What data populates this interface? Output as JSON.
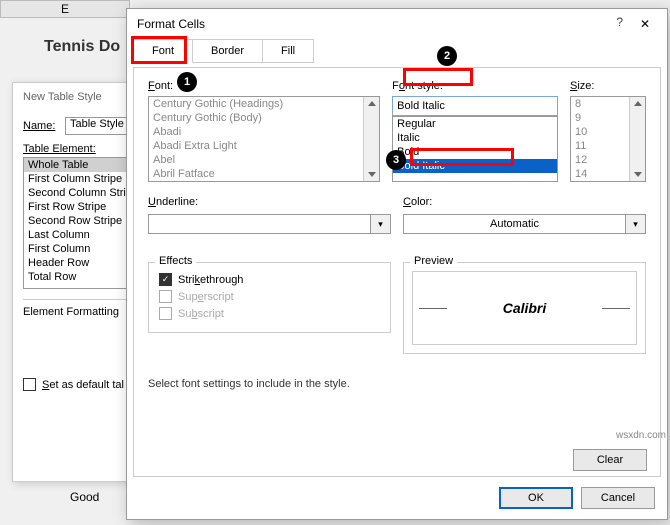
{
  "bg": {
    "col_letter": "E",
    "title_text": "Tennis Do",
    "good": "Good"
  },
  "first_dialog": {
    "title": "New Table Style",
    "name_label": "Name:",
    "name_value": "Table Style",
    "element_label": "Table Element:",
    "elements": [
      "Whole Table",
      "First Column Stripe",
      "Second Column Stripe",
      "First Row Stripe",
      "Second Row Stripe",
      "Last Column",
      "First Column",
      "Header Row",
      "Total Row"
    ],
    "selected_element": "Whole Table",
    "formatting_label": "Element Formatting",
    "default_label": "Set as default table"
  },
  "fc": {
    "title": "Format Cells",
    "tabs": {
      "font": "Font",
      "border": "Border",
      "fill": "Fill"
    },
    "font_label": "Font:",
    "fonts": [
      "Century Gothic (Headings)",
      "Century Gothic (Body)",
      "Abadi",
      "Abadi Extra Light",
      "Abel",
      "Abril Fatface"
    ],
    "style_label": "Font style:",
    "style_value": "Bold Italic",
    "styles": [
      "Regular",
      "Italic",
      "Bold",
      "Bold Italic"
    ],
    "size_label": "Size:",
    "sizes": [
      "8",
      "9",
      "10",
      "11",
      "12",
      "14"
    ],
    "underline_label": "Underline:",
    "underline_value": "",
    "color_label": "Color:",
    "color_value": "Automatic",
    "effects_label": "Effects",
    "strike": "Strikethrough",
    "super": "Superscript",
    "sub": "Subscript",
    "preview_label": "Preview",
    "preview_text": "Calibri",
    "instruction": "Select font settings to include in the style.",
    "clear": "Clear",
    "ok": "OK",
    "cancel": "Cancel"
  },
  "badges": {
    "b1": "1",
    "b2": "2",
    "b3": "3"
  },
  "watermark": "wsxdn.com"
}
